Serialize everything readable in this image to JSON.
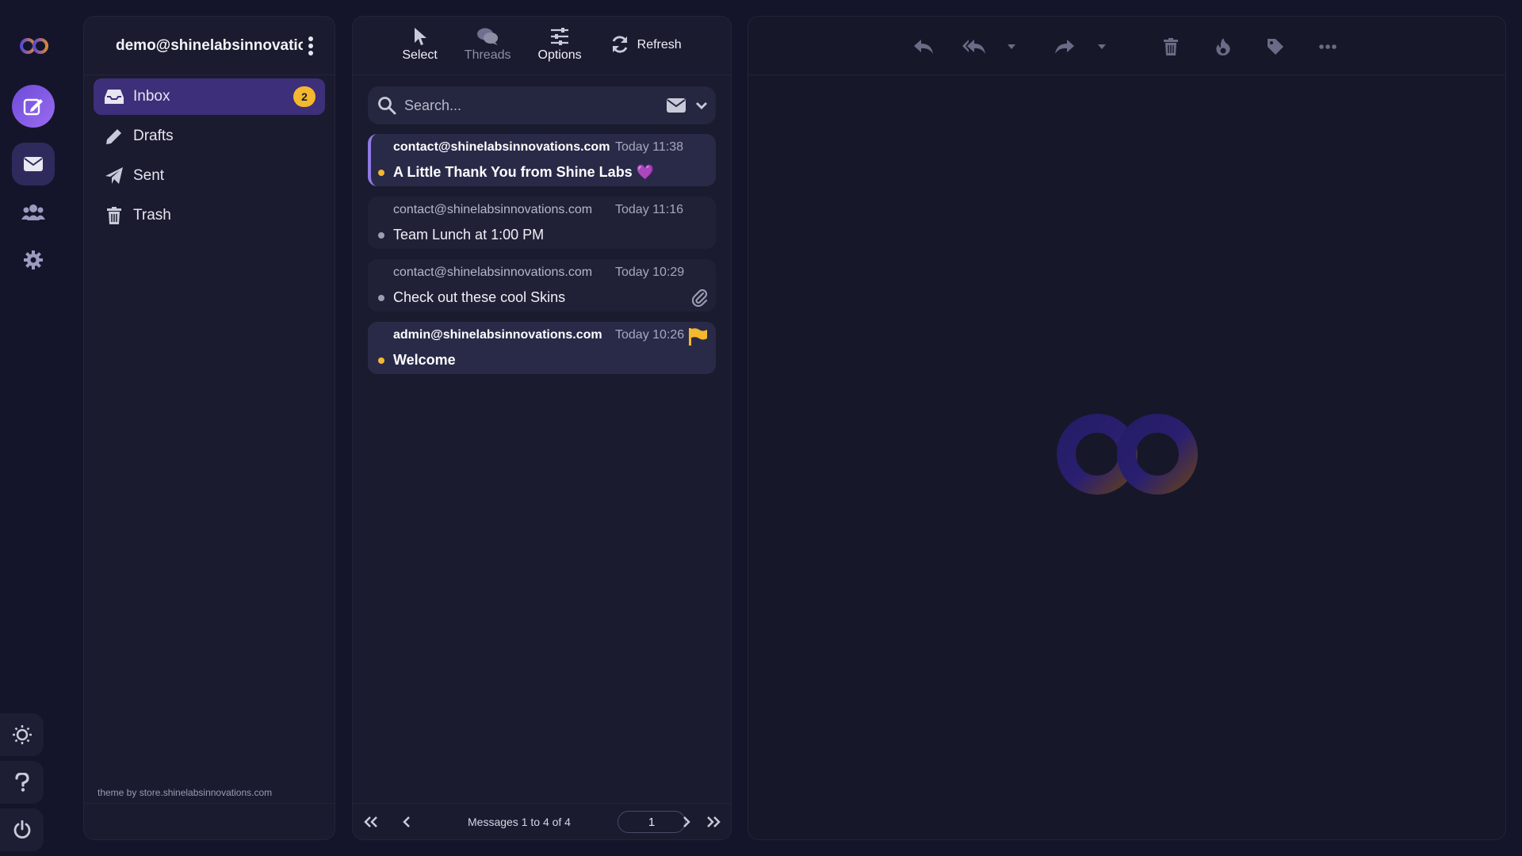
{
  "rail": {
    "logo_icon": "infinity-logo-icon",
    "items": [
      "compose-icon",
      "mail-icon",
      "contacts-icon",
      "settings-gear-icon"
    ],
    "bottom": [
      "theme-toggle-icon",
      "help-icon",
      "power-icon"
    ]
  },
  "account": {
    "email": "demo@shinelabsinnovatio..."
  },
  "folders": [
    {
      "label": "Inbox",
      "icon": "inbox-icon",
      "unread": "2",
      "active": true
    },
    {
      "label": "Drafts",
      "icon": "pencil-icon"
    },
    {
      "label": "Sent",
      "icon": "paper-plane-icon"
    },
    {
      "label": "Trash",
      "icon": "trash-icon"
    }
  ],
  "theme_credit": "theme by store.shinelabsinnovations.com",
  "toolbar": {
    "select": "Select",
    "threads": "Threads",
    "options": "Options",
    "refresh": "Refresh"
  },
  "search": {
    "placeholder": "Search..."
  },
  "messages": [
    {
      "from": "contact@shinelabsinnovations.com",
      "date": "Today 11:38",
      "subject": "A Little Thank You from Shine Labs 💜",
      "unread": true,
      "selected": true
    },
    {
      "from": "contact@shinelabsinnovations.com",
      "date": "Today 11:16",
      "subject": "Team Lunch at 1:00 PM",
      "unread": false
    },
    {
      "from": "contact@shinelabsinnovations.com",
      "date": "Today 10:29",
      "subject": "Check out these cool Skins",
      "unread": false,
      "attachment": true
    },
    {
      "from": "admin@shinelabsinnovations.com",
      "date": "Today 10:26",
      "subject": "Welcome",
      "unread": true,
      "flagged": true
    }
  ],
  "pager": {
    "count_text": "Messages 1 to 4 of 4",
    "page": "1"
  },
  "reader_toolbar": [
    "reply-icon",
    "reply-all-icon",
    "reply-all-menu-icon",
    "forward-icon",
    "forward-menu-icon",
    "delete-icon",
    "fire-icon",
    "tag-icon",
    "more-icon"
  ],
  "colors": {
    "accent": "#8f7ae6",
    "unread_dot": "#f4b82e",
    "flag": "#f4b82e"
  }
}
